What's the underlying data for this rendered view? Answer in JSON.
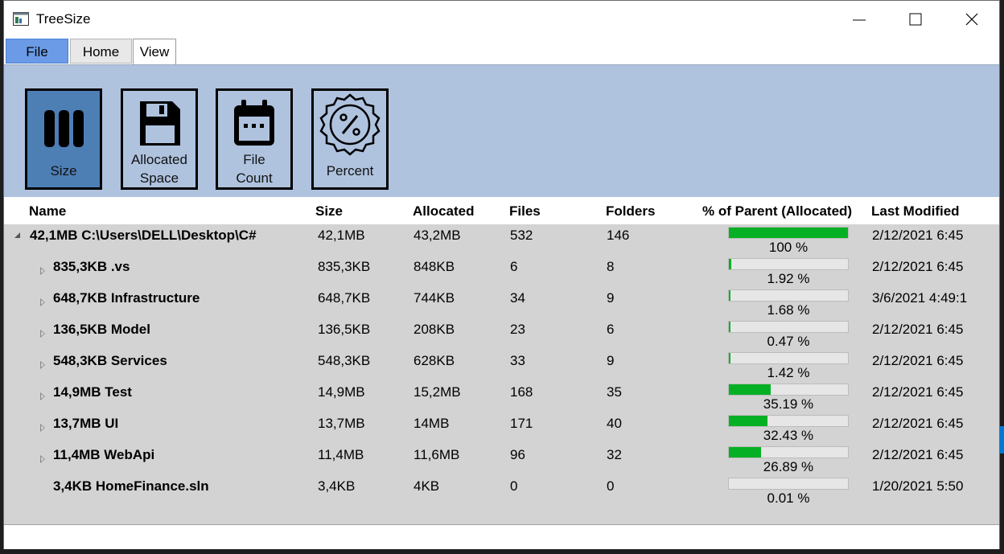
{
  "window": {
    "title": "TreeSize"
  },
  "tabs": [
    {
      "label": "File"
    },
    {
      "label": "Home"
    },
    {
      "label": "View"
    }
  ],
  "ribbon": {
    "buttons": [
      {
        "label_line1": "",
        "label_line2": "Size",
        "icon": "size-bars-icon"
      },
      {
        "label_line1": "Allocated",
        "label_line2": "Space",
        "icon": "floppy-disk-icon"
      },
      {
        "label_line1": "File",
        "label_line2": "Count",
        "icon": "calendar-icon"
      },
      {
        "label_line1": "",
        "label_line2": "Percent",
        "icon": "percent-badge-icon"
      }
    ],
    "active_color": "#4d7fb5",
    "background_color": "#afc3df"
  },
  "table": {
    "headers": [
      "Name",
      "Size",
      "Allocated",
      "Files",
      "Folders",
      "% of Parent (Allocated)",
      "Last Modified"
    ],
    "rows": [
      {
        "name": "42,1MB C:\\Users\\DELL\\Desktop\\C#",
        "size": "42,1MB",
        "allocated": "43,2MB",
        "files": "532",
        "folders": "146",
        "percent": "100 %",
        "percent_value": 100,
        "modified": "2/12/2021 6:45",
        "expander": "open",
        "level": 0
      },
      {
        "name": "835,3KB .vs",
        "size": "835,3KB",
        "allocated": "848KB",
        "files": "6",
        "folders": "8",
        "percent": "1.92 %",
        "percent_value": 1.92,
        "modified": "2/12/2021 6:45",
        "expander": "closed",
        "level": 1
      },
      {
        "name": "648,7KB Infrastructure",
        "size": "648,7KB",
        "allocated": "744KB",
        "files": "34",
        "folders": "9",
        "percent": "1.68 %",
        "percent_value": 1.68,
        "modified": "3/6/2021 4:49:1",
        "expander": "closed",
        "level": 1
      },
      {
        "name": "136,5KB Model",
        "size": "136,5KB",
        "allocated": "208KB",
        "files": "23",
        "folders": "6",
        "percent": "0.47 %",
        "percent_value": 0.47,
        "modified": "2/12/2021 6:45",
        "expander": "closed",
        "level": 1
      },
      {
        "name": "548,3KB Services",
        "size": "548,3KB",
        "allocated": "628KB",
        "files": "33",
        "folders": "9",
        "percent": "1.42 %",
        "percent_value": 1.42,
        "modified": "2/12/2021 6:45",
        "expander": "closed",
        "level": 1
      },
      {
        "name": "14,9MB Test",
        "size": "14,9MB",
        "allocated": "15,2MB",
        "files": "168",
        "folders": "35",
        "percent": "35.19 %",
        "percent_value": 35.19,
        "modified": "2/12/2021 6:45",
        "expander": "closed",
        "level": 1
      },
      {
        "name": "13,7MB UI",
        "size": "13,7MB",
        "allocated": "14MB",
        "files": "171",
        "folders": "40",
        "percent": "32.43 %",
        "percent_value": 32.43,
        "modified": "2/12/2021 6:45",
        "expander": "closed",
        "level": 1
      },
      {
        "name": "11,4MB WebApi",
        "size": "11,4MB",
        "allocated": "11,6MB",
        "files": "96",
        "folders": "32",
        "percent": "26.89 %",
        "percent_value": 26.89,
        "modified": "2/12/2021 6:45",
        "expander": "closed",
        "level": 1
      },
      {
        "name": "3,4KB HomeFinance.sln",
        "size": "3,4KB",
        "allocated": "4KB",
        "files": "0",
        "folders": "0",
        "percent": "0.01 %",
        "percent_value": 0.01,
        "modified": "1/20/2021 5:50",
        "expander": "none",
        "level": 1
      }
    ],
    "bar_color": "#06b025"
  }
}
